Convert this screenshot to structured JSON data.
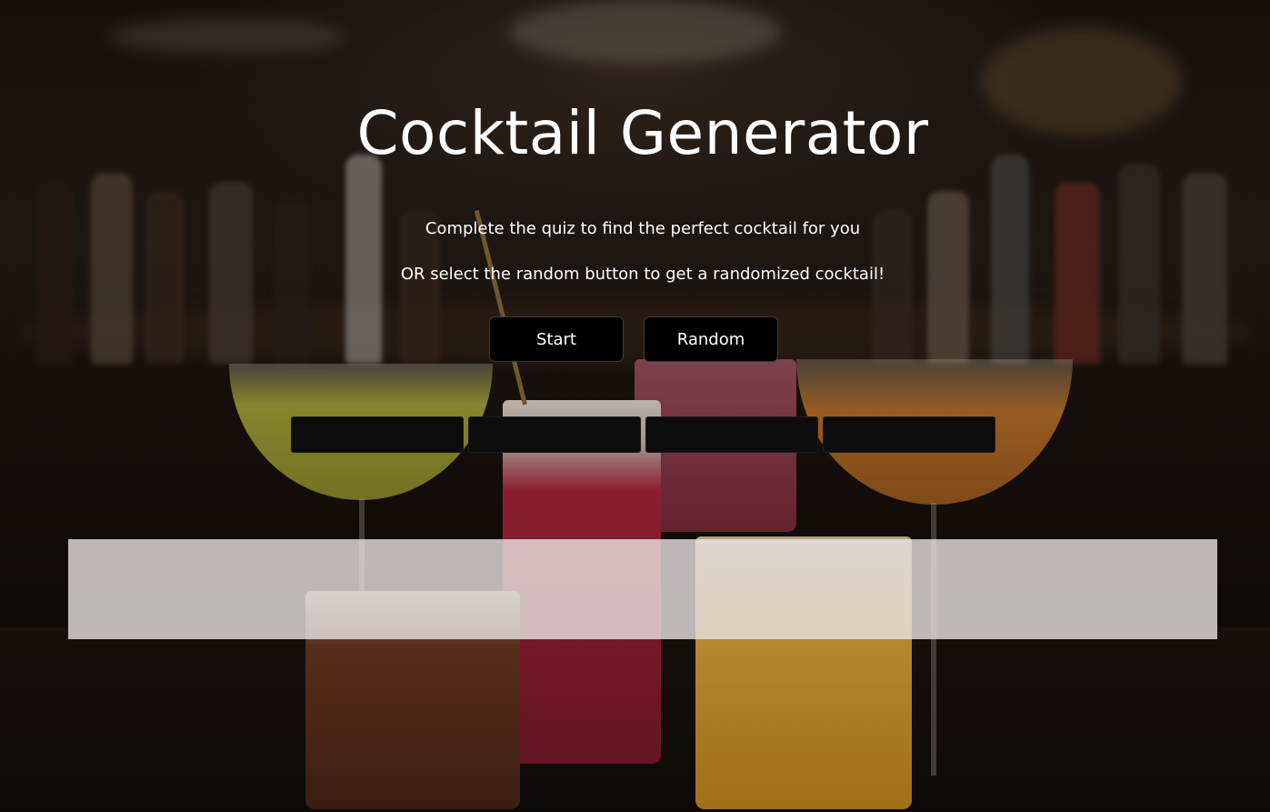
{
  "page": {
    "title": "Cocktail Generator",
    "subtitle_line1": "Complete the quiz to find the perfect cocktail for you",
    "subtitle_line2": "OR select the random button to get a randomized cocktail!"
  },
  "buttons": {
    "start_label": "Start",
    "random_label": "Random"
  },
  "quiz_slots": [
    {
      "label": ""
    },
    {
      "label": ""
    },
    {
      "label": ""
    },
    {
      "label": ""
    }
  ],
  "result": {
    "text": ""
  },
  "colors": {
    "title_text": "#ffffff",
    "button_bg": "#000000",
    "slot_bg": "#0c0c0c",
    "result_panel": "#e8e4e4"
  },
  "background": {
    "icon": "cocktails-bar-photo"
  }
}
